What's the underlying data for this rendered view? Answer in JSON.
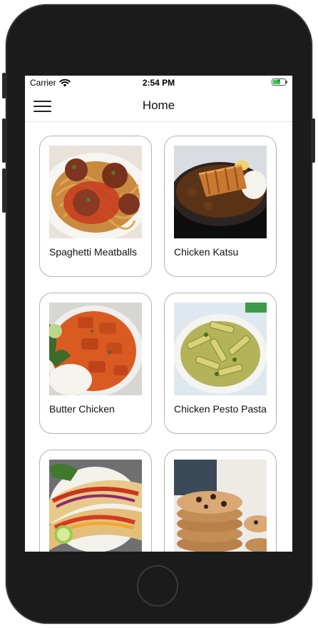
{
  "status": {
    "carrier": "Carrier",
    "time": "2:54 PM",
    "battery_color": "#34c759"
  },
  "nav": {
    "title": "Home",
    "menu_icon": "hamburger-menu-icon"
  },
  "recipes": [
    {
      "name": "Spaghetti Meatballs",
      "image": "spaghetti-meatballs-photo"
    },
    {
      "name": "Chicken Katsu",
      "image": "chicken-katsu-photo"
    },
    {
      "name": "Butter Chicken",
      "image": "butter-chicken-photo"
    },
    {
      "name": "Chicken Pesto Pasta",
      "image": "chicken-pesto-pasta-photo"
    },
    {
      "name": "",
      "image": "fajita-tacos-photo"
    },
    {
      "name": "",
      "image": "chocolate-chip-cookies-photo"
    }
  ]
}
